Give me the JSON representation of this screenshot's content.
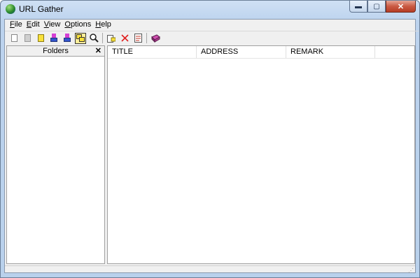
{
  "window": {
    "title": "URL Gather"
  },
  "caption_buttons": {
    "minimize": "▬",
    "maximize": "▢",
    "close": "✕"
  },
  "menu": [
    {
      "accel": "F",
      "rest": "ile"
    },
    {
      "accel": "E",
      "rest": "dit"
    },
    {
      "accel": "V",
      "rest": "iew"
    },
    {
      "accel": "O",
      "rest": "ptions"
    },
    {
      "accel": "H",
      "rest": "elp"
    }
  ],
  "folders_panel": {
    "title": "Folders",
    "close": "✕"
  },
  "list": {
    "columns": [
      "TITLE",
      "ADDRESS",
      "REMARK"
    ]
  },
  "toolbar": {
    "icons": [
      "new-doc-icon",
      "gray-doc-icon",
      "yellow-doc-icon",
      "import-icon",
      "export-icon",
      "folder-view-icon",
      "search-icon",
      "add-icon",
      "delete-icon",
      "properties-icon",
      "book-icon"
    ]
  },
  "colors": {
    "close_button": "#c95a43",
    "active_toolbar": "#ffef9a"
  }
}
